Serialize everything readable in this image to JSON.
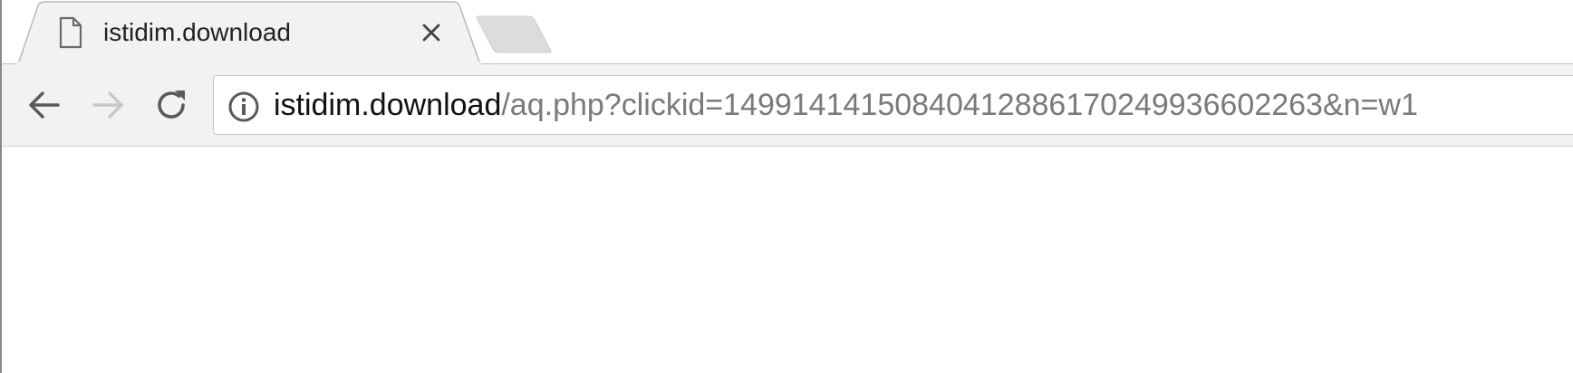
{
  "tab": {
    "title": "istidim.download",
    "favicon_icon": "page-icon",
    "close_icon": "close-icon"
  },
  "new_tab": {
    "icon": "new-tab-icon"
  },
  "toolbar": {
    "back_icon": "arrow-left-icon",
    "forward_icon": "arrow-right-icon",
    "forward_enabled": false,
    "reload_icon": "reload-icon"
  },
  "omnibox": {
    "security_icon": "info-icon",
    "url_host": "istidim.download",
    "url_path": "/aq.php?clickid=14991414150840412886170249936602263&n=w1"
  },
  "colors": {
    "tab_strip": "#ffffff",
    "toolbar": "#f2f2f2",
    "icon": "#5a5a5a",
    "icon_disabled": "#c8c8c8",
    "url_host": "#111111",
    "url_path": "#7a7a7a"
  }
}
